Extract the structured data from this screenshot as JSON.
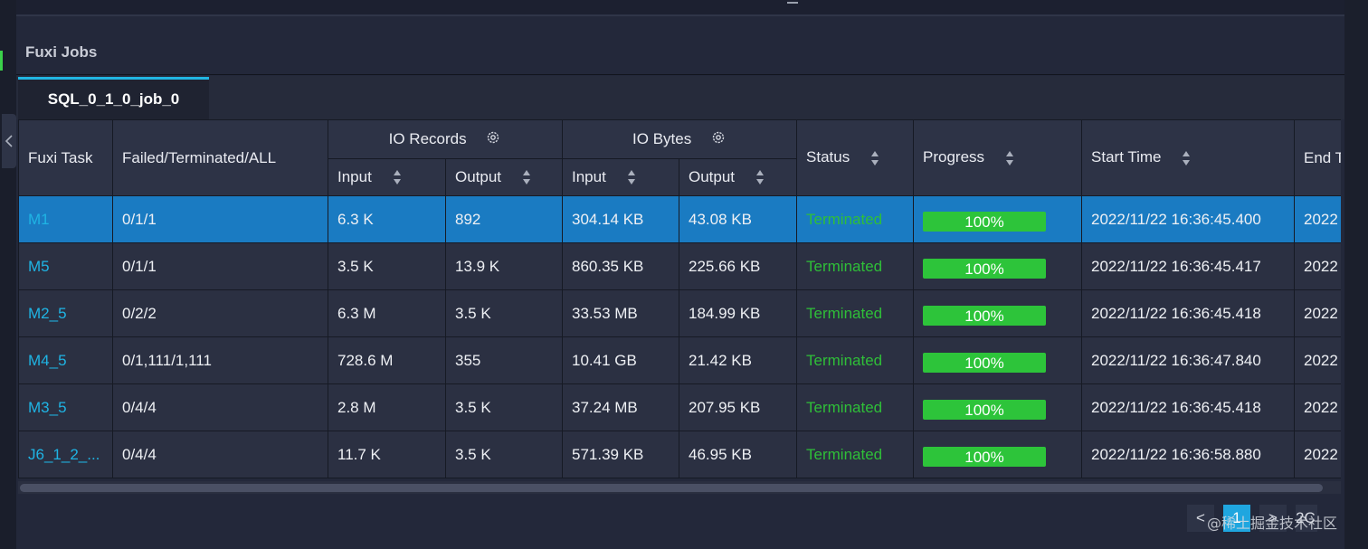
{
  "panel": {
    "title": "Fuxi Jobs"
  },
  "tabs": [
    {
      "label": "SQL_0_1_0_job_0",
      "active": true
    }
  ],
  "table": {
    "headers": {
      "task": "Fuxi Task",
      "failed": "Failed/Terminated/ALL",
      "io_records": "IO Records",
      "io_bytes": "IO Bytes",
      "status": "Status",
      "progress": "Progress",
      "start_time": "Start Time",
      "end_time": "End T",
      "records_input": "Input",
      "records_output": "Output",
      "bytes_input": "Input",
      "bytes_output": "Output"
    },
    "rows": [
      {
        "task": "M1",
        "failed": "0/1/1",
        "rec_in": "6.3 K",
        "rec_out": "892",
        "bytes_in": "304.14 KB",
        "bytes_out": "43.08 KB",
        "status": "Terminated",
        "progress": "100%",
        "start": "2022/11/22 16:36:45.400",
        "end": "2022"
      },
      {
        "task": "M5",
        "failed": "0/1/1",
        "rec_in": "3.5 K",
        "rec_out": "13.9 K",
        "bytes_in": "860.35 KB",
        "bytes_out": "225.66 KB",
        "status": "Terminated",
        "progress": "100%",
        "start": "2022/11/22 16:36:45.417",
        "end": "2022"
      },
      {
        "task": "M2_5",
        "failed": "0/2/2",
        "rec_in": "6.3 M",
        "rec_out": "3.5 K",
        "bytes_in": "33.53 MB",
        "bytes_out": "184.99 KB",
        "status": "Terminated",
        "progress": "100%",
        "start": "2022/11/22 16:36:45.418",
        "end": "2022"
      },
      {
        "task": "M4_5",
        "failed": "0/1,111/1,111",
        "rec_in": "728.6 M",
        "rec_out": "355",
        "bytes_in": "10.41 GB",
        "bytes_out": "21.42 KB",
        "status": "Terminated",
        "progress": "100%",
        "start": "2022/11/22 16:36:47.840",
        "end": "2022"
      },
      {
        "task": "M3_5",
        "failed": "0/4/4",
        "rec_in": "2.8 M",
        "rec_out": "3.5 K",
        "bytes_in": "37.24 MB",
        "bytes_out": "207.95 KB",
        "status": "Terminated",
        "progress": "100%",
        "start": "2022/11/22 16:36:45.418",
        "end": "2022"
      },
      {
        "task": "J6_1_2_...",
        "failed": "0/4/4",
        "rec_in": "11.7 K",
        "rec_out": "3.5 K",
        "bytes_in": "571.39 KB",
        "bytes_out": "46.95 KB",
        "status": "Terminated",
        "progress": "100%",
        "start": "2022/11/22 16:36:58.880",
        "end": "2022"
      }
    ],
    "progress_fraction": 1.0
  },
  "pagination": {
    "prev": "<",
    "current": "1",
    "next": ">",
    "page_size_partial": "2C"
  },
  "watermark": "@稀土掘金技术社区",
  "colors": {
    "accent": "#21b6e3",
    "selected_row": "#1a7bc2",
    "status_terminated": "#2fbf38",
    "progress_fill": "#2dc43a",
    "link": "#1fb4e4"
  },
  "icons": {
    "collapse": "chevron-left-icon",
    "settings": "gear-icon",
    "sort": "sort-icon"
  }
}
